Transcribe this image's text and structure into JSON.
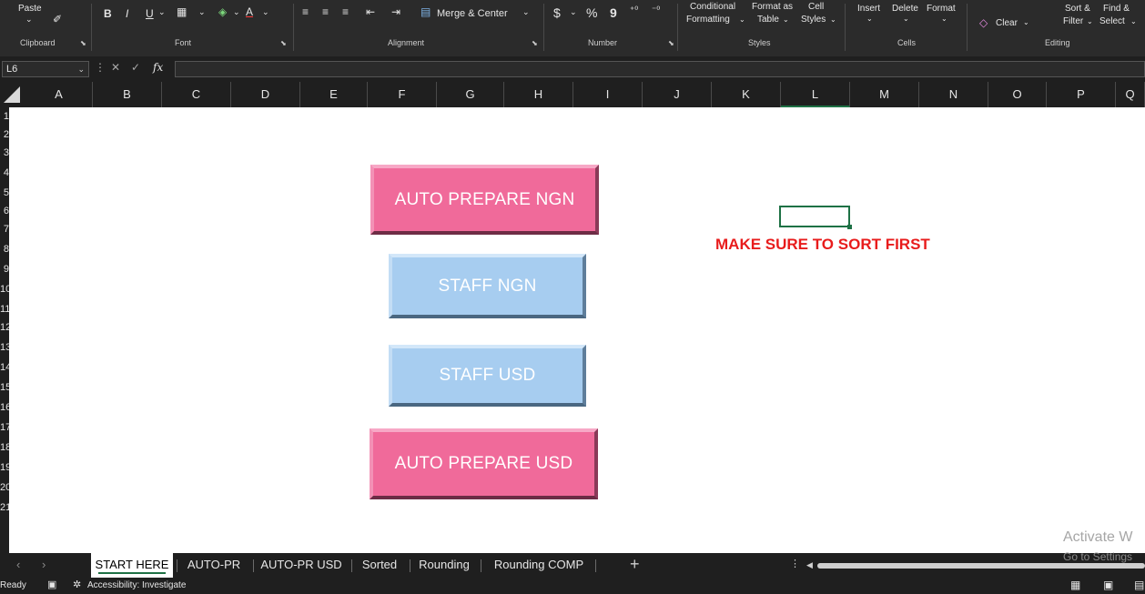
{
  "ribbon": {
    "clipboard": {
      "paste_label": "Paste",
      "group_label": "Clipboard"
    },
    "font": {
      "bold": "B",
      "italic": "I",
      "underline": "U",
      "group_label": "Font"
    },
    "alignment": {
      "merge_label": "Merge & Center",
      "group_label": "Alignment"
    },
    "number": {
      "currency": "$",
      "percent": "%",
      "comma": "9",
      "group_label": "Number"
    },
    "styles": {
      "conditional_line1": "Conditional",
      "conditional_line2": "Formatting",
      "format_table_line1": "Format as",
      "format_table_line2": "Table",
      "cell_styles_line1": "Cell",
      "cell_styles_line2": "Styles",
      "group_label": "Styles"
    },
    "cells": {
      "insert": "Insert",
      "delete": "Delete",
      "format": "Format",
      "group_label": "Cells"
    },
    "editing": {
      "clear": "Clear",
      "sort_line1": "Sort &",
      "sort_line2": "Filter",
      "find_line1": "Find &",
      "find_line2": "Select",
      "group_label": "Editing"
    }
  },
  "formula_bar": {
    "name_box": "L6",
    "fx": "fx"
  },
  "columns": [
    "A",
    "B",
    "C",
    "D",
    "E",
    "F",
    "G",
    "H",
    "I",
    "J",
    "K",
    "L",
    "M",
    "N",
    "O",
    "P",
    "Q"
  ],
  "rows": [
    "1",
    "2",
    "3",
    "4",
    "5",
    "6",
    "7",
    "8",
    "9",
    "10",
    "11",
    "12",
    "13",
    "14",
    "15",
    "16",
    "17",
    "18",
    "19",
    "20",
    "21"
  ],
  "buttons": {
    "auto_prepare_ngn": "AUTO PREPARE NGN",
    "staff_ngn": "STAFF NGN",
    "staff_usd": "STAFF USD",
    "auto_prepare_usd": "AUTO PREPARE USD"
  },
  "warning_text": "MAKE SURE TO SORT FIRST",
  "watermark": {
    "line1": "Activate W",
    "line2": "Go to Settings"
  },
  "sheet_tabs": [
    "START HERE",
    "AUTO-PR",
    "AUTO-PR USD",
    "Sorted",
    "Rounding",
    "Rounding COMP"
  ],
  "active_tab": "START HERE",
  "status": {
    "ready": "Ready",
    "accessibility": "Accessibility: Investigate"
  },
  "colors": {
    "pink_button": "#f06a9a",
    "blue_button": "#a7cdf0",
    "warning": "#e81c1c",
    "selection": "#1e7145"
  }
}
